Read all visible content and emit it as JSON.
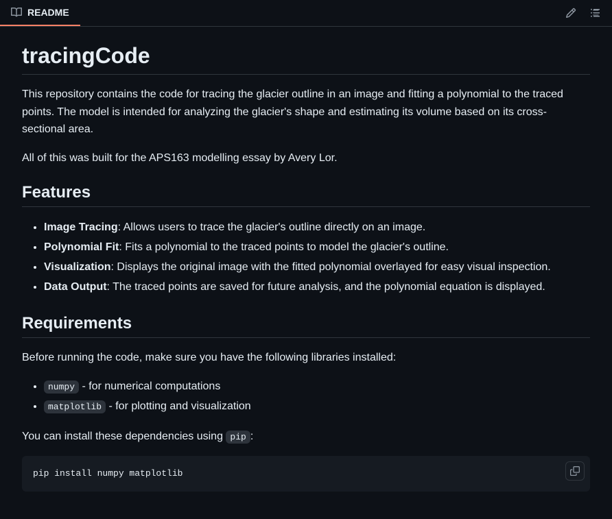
{
  "header": {
    "readme_label": "README"
  },
  "title": "tracingCode",
  "intro_p1": "This repository contains the code for tracing the glacier outline in an image and fitting a polynomial to the traced points. The model is intended for analyzing the glacier's shape and estimating its volume based on its cross-sectional area.",
  "intro_p2": "All of this was built for the APS163 modelling essay by Avery Lor.",
  "features": {
    "heading": "Features",
    "items": [
      {
        "bold": "Image Tracing",
        "text": ": Allows users to trace the glacier's outline directly on an image."
      },
      {
        "bold": "Polynomial Fit",
        "text": ": Fits a polynomial to the traced points to model the glacier's outline."
      },
      {
        "bold": "Visualization",
        "text": ": Displays the original image with the fitted polynomial overlayed for easy visual inspection."
      },
      {
        "bold": "Data Output",
        "text": ": The traced points are saved for future analysis, and the polynomial equation is displayed."
      }
    ]
  },
  "requirements": {
    "heading": "Requirements",
    "intro": "Before running the code, make sure you have the following libraries installed:",
    "libs": [
      {
        "code": "numpy",
        "text": " - for numerical computations"
      },
      {
        "code": "matplotlib",
        "text": " - for plotting and visualization"
      }
    ],
    "install_text_pre": "You can install these dependencies using ",
    "install_code": "pip",
    "install_text_post": ":",
    "pip_command": "pip install numpy matplotlib"
  }
}
